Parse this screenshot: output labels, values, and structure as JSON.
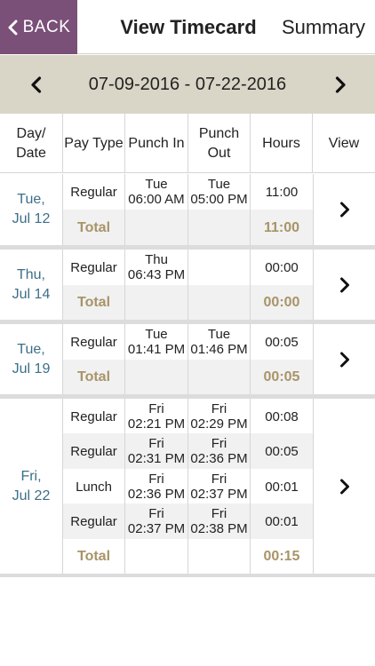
{
  "nav": {
    "back_label": "BACK",
    "title": "View Timecard",
    "summary_label": "Summary",
    "date_range": "07-09-2016 - 07-22-2016"
  },
  "columns": {
    "day_line1": "Day/",
    "day_line2": "Date",
    "pay_type": "Pay Type",
    "punch_in": "Punch In",
    "punch_out_line1": "Punch",
    "punch_out_line2": "Out",
    "hours": "Hours",
    "view": "View"
  },
  "groups": [
    {
      "day_line1": "Tue,",
      "day_line2": "Jul 12",
      "rows": [
        {
          "pay_type": "Regular",
          "in_day": "Tue",
          "in_time": "06:00 AM",
          "out_day": "Tue",
          "out_time": "05:00 PM",
          "hours": "11:00"
        }
      ],
      "total_label": "Total",
      "total_hours": "11:00"
    },
    {
      "day_line1": "Thu,",
      "day_line2": "Jul 14",
      "rows": [
        {
          "pay_type": "Regular",
          "in_day": "Thu",
          "in_time": "06:43 PM",
          "out_day": "",
          "out_time": "",
          "hours": "00:00"
        }
      ],
      "total_label": "Total",
      "total_hours": "00:00"
    },
    {
      "day_line1": "Tue,",
      "day_line2": "Jul 19",
      "rows": [
        {
          "pay_type": "Regular",
          "in_day": "Tue",
          "in_time": "01:41 PM",
          "out_day": "Tue",
          "out_time": "01:46 PM",
          "hours": "00:05"
        }
      ],
      "total_label": "Total",
      "total_hours": "00:05"
    },
    {
      "day_line1": "Fri,",
      "day_line2": "Jul 22",
      "rows": [
        {
          "pay_type": "Regular",
          "in_day": "Fri",
          "in_time": "02:21 PM",
          "out_day": "Fri",
          "out_time": "02:29 PM",
          "hours": "00:08"
        },
        {
          "pay_type": "Regular",
          "in_day": "Fri",
          "in_time": "02:31 PM",
          "out_day": "Fri",
          "out_time": "02:36 PM",
          "hours": "00:05"
        },
        {
          "pay_type": "Lunch",
          "in_day": "Fri",
          "in_time": "02:36 PM",
          "out_day": "Fri",
          "out_time": "02:37 PM",
          "hours": "00:01"
        },
        {
          "pay_type": "Regular",
          "in_day": "Fri",
          "in_time": "02:37 PM",
          "out_day": "Fri",
          "out_time": "02:38 PM",
          "hours": "00:01"
        }
      ],
      "total_label": "Total",
      "total_hours": "00:15"
    }
  ],
  "colors": {
    "back_bg": "#7a4f78",
    "date_bar_bg": "#d9d6c7",
    "day_text": "#3d6f87",
    "total_text": "#a89468"
  },
  "icons": {
    "back": "chevron-left-icon",
    "prev": "chevron-left-icon",
    "next": "chevron-right-icon",
    "view": "chevron-right-icon"
  }
}
